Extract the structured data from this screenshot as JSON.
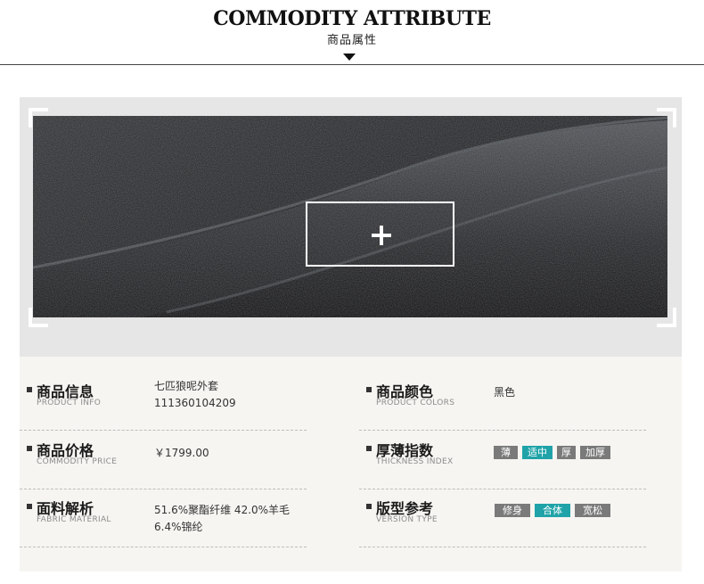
{
  "header": {
    "title_en": "COMMODITY ATTRIBUTE",
    "title_cn": "商品属性"
  },
  "colors": {
    "tag_default": "#7a7a7a",
    "tag_active": "#1fa3a8",
    "panel_bg": "#f6f5f2"
  },
  "product_info": {
    "label_cn": "商品信息",
    "label_en": "PRODUCT INFO",
    "name": "七匹狼呢外套",
    "code": "111360104209"
  },
  "product_colors": {
    "label_cn": "商品颜色",
    "label_en": "PRODUCT COLORS",
    "value": "黑色"
  },
  "commodity_price": {
    "label_cn": "商品价格",
    "label_en": "COMMODITY PRICE",
    "value": "￥1799.00"
  },
  "thickness": {
    "label_cn": "厚薄指数",
    "label_en": "THICKNESS INDEX",
    "options": [
      "薄",
      "适中",
      "厚",
      "加厚"
    ],
    "selected": "适中"
  },
  "fabric": {
    "label_cn": "面料解析",
    "label_en": "FABRIC MATERIAL",
    "line1": "51.6%聚酯纤维 42.0%羊毛",
    "line2": "6.4%锦纶"
  },
  "version_type": {
    "label_cn": "版型参考",
    "label_en": "VERSION TYPE",
    "options": [
      "修身",
      "合体",
      "宽松"
    ],
    "selected": "合体"
  },
  "icons": {
    "zoom": "zoom-plus-icon",
    "header_arrow": "caret-down-icon"
  }
}
